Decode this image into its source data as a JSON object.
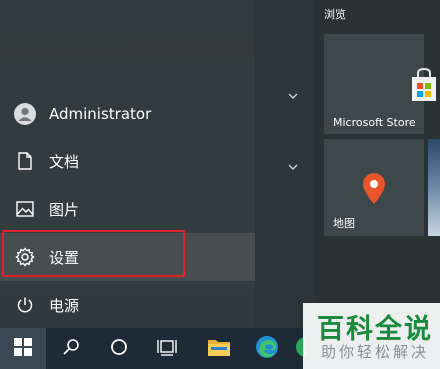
{
  "start_menu": {
    "items": [
      {
        "label": "Administrator",
        "icon": "user-avatar-icon"
      },
      {
        "label": "文档",
        "icon": "document-icon"
      },
      {
        "label": "图片",
        "icon": "picture-icon"
      },
      {
        "label": "设置",
        "icon": "gear-icon"
      },
      {
        "label": "电源",
        "icon": "power-icon"
      }
    ]
  },
  "tiles": {
    "section_title": "浏览",
    "items": [
      {
        "label": "Microsoft Store",
        "icon": "store-bag-icon"
      },
      {
        "label": "地图",
        "icon": "map-pin-icon"
      }
    ]
  },
  "taskbar": {
    "icons": [
      "windows-start-icon",
      "search-icon",
      "cortana-icon",
      "task-view-icon",
      "file-explorer-icon",
      "edge-icon"
    ]
  },
  "watermark": {
    "title": "百科全说",
    "subtitle": "助你轻松解决"
  },
  "colors": {
    "highlight": "#e0232a",
    "watermark_green": "#1a8a3c",
    "map_pin": "#e8552a"
  }
}
